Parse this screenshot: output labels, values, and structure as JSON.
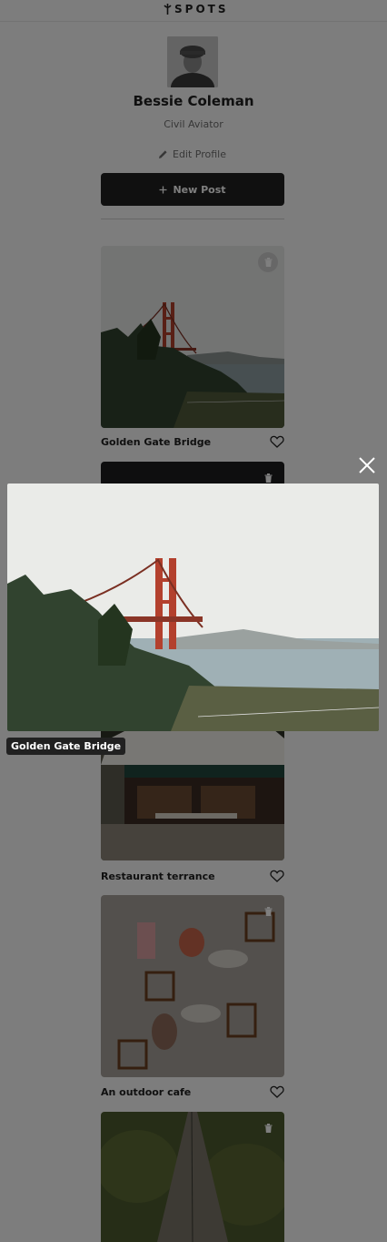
{
  "app": {
    "logo_text": "SPOTS"
  },
  "profile": {
    "name": "Bessie Coleman",
    "description": "Civil Aviator",
    "edit_label": "Edit Profile",
    "new_post_label": "New Post"
  },
  "cards": [
    {
      "title": "Golden Gate Bridge"
    },
    {
      "title": ""
    },
    {
      "title": "Restaurant terrance"
    },
    {
      "title": "An outdoor cafe"
    },
    {
      "title": ""
    }
  ],
  "modal": {
    "caption": "Golden Gate Bridge"
  },
  "icons": {
    "logo": "spots-logo-icon",
    "edit": "pencil-icon",
    "add": "plus-icon",
    "like": "heart-icon",
    "delete": "trash-icon",
    "close": "close-icon"
  },
  "colors": {
    "primary": "#212121",
    "background": "#fafafa",
    "secondary_text": "#6f6f6f"
  }
}
